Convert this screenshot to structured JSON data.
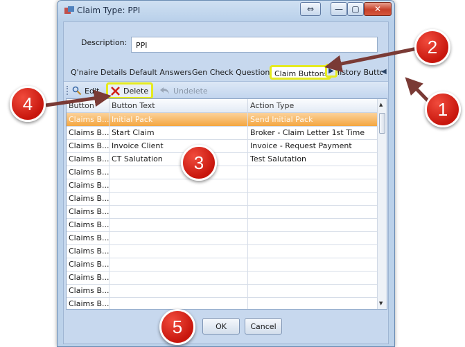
{
  "window": {
    "title": "Claim Type: PPI",
    "controls": [
      "⇔",
      "—",
      "▢",
      "✕"
    ]
  },
  "description": {
    "label": "Description:",
    "value": "PPI"
  },
  "tabs": [
    {
      "label": "Q'naire Details Default Answers"
    },
    {
      "label": "Gen Check Question"
    },
    {
      "label": "Claim Buttons"
    },
    {
      "label": "History Butto"
    }
  ],
  "toolbar": {
    "edit_label": "Edit",
    "delete_label": "Delete",
    "undelete_label": "Undelete"
  },
  "grid": {
    "columns": [
      "Button",
      "Button Text",
      "Action Type"
    ],
    "rows": [
      [
        "Claims B...",
        "Initial Pack",
        "Send Initial Pack"
      ],
      [
        "Claims B...",
        "Start Claim",
        "Broker - Claim Letter 1st Time"
      ],
      [
        "Claims B...",
        "Invoice Client",
        "Invoice - Request Payment"
      ],
      [
        "Claims B...",
        "CT Salutation",
        "Test Salutation"
      ],
      [
        "Claims B...",
        "",
        ""
      ],
      [
        "Claims B...",
        "",
        ""
      ],
      [
        "Claims B...",
        "",
        ""
      ],
      [
        "Claims B...",
        "",
        ""
      ],
      [
        "Claims B...",
        "",
        ""
      ],
      [
        "Claims B...",
        "",
        ""
      ],
      [
        "Claims B...",
        "",
        ""
      ],
      [
        "Claims B...",
        "",
        ""
      ],
      [
        "Claims B...",
        "",
        ""
      ],
      [
        "Claims B...",
        "",
        ""
      ],
      [
        "Claims B...",
        "",
        ""
      ]
    ],
    "selected_row": 0
  },
  "buttons": {
    "ok": "OK",
    "cancel": "Cancel"
  },
  "callouts": {
    "c1": "1",
    "c2": "2",
    "c3": "3",
    "c4": "4",
    "c5": "5"
  },
  "colors": {
    "highlight": "#e5ea1f",
    "callout": "#c8160d",
    "selected_row": "#f4a640"
  }
}
